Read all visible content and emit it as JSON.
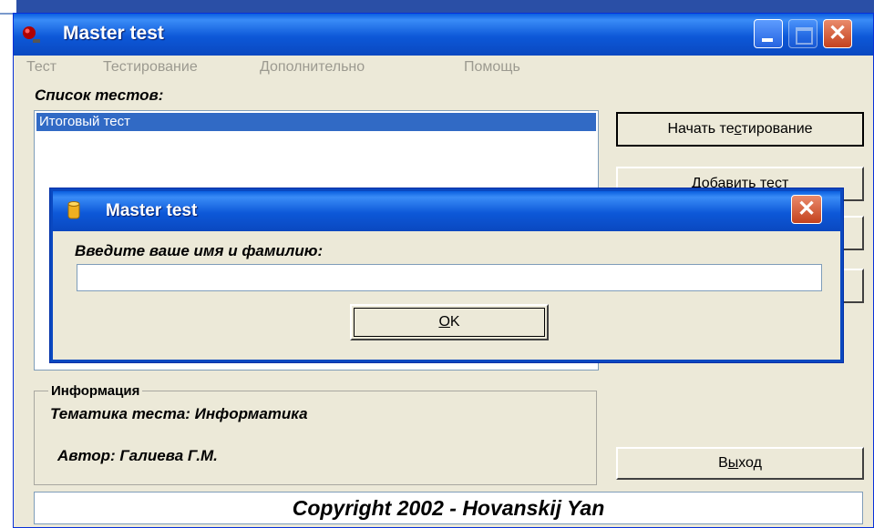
{
  "window": {
    "title": "Master test",
    "accent": "#0a5fe0"
  },
  "menu": [
    "Тест",
    "Тестирование",
    "Дополнительно",
    "Помощь"
  ],
  "tests": {
    "label": "Список тестов:",
    "items": [
      {
        "label": "Итоговый тест",
        "selected": true
      }
    ]
  },
  "buttons": {
    "start_pre": "Начать те",
    "start_ul": "с",
    "start_post": "тирование",
    "add": "Добавить тест",
    "exit_pre": "В",
    "exit_ul": "ы",
    "exit_post": "ход"
  },
  "info": {
    "legend": "Информация",
    "topic": "Тематика теста: Информатика",
    "author": "Автор: Галиева Г.М."
  },
  "footer": {
    "copyright": "Copyright 2002 - Hovanskij Yan"
  },
  "dialog": {
    "title": "Master test",
    "prompt": "Введите ваше имя и фамилию:",
    "input_value": "",
    "ok_ul": "O",
    "ok_post": "K"
  }
}
